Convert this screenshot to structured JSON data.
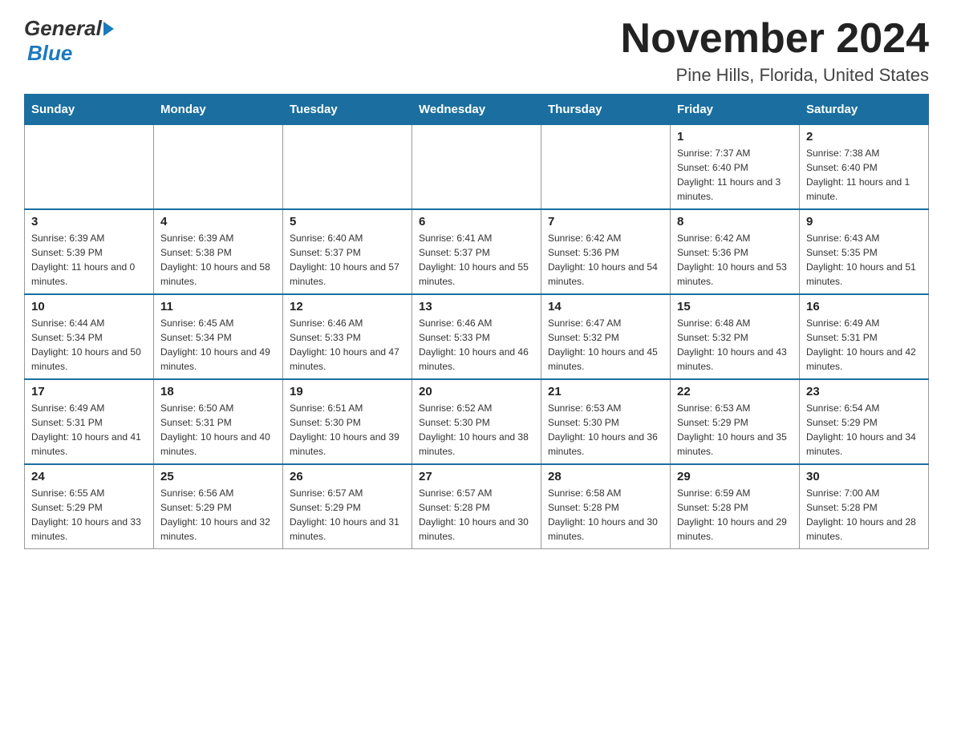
{
  "header": {
    "title": "November 2024",
    "subtitle": "Pine Hills, Florida, United States",
    "logo_general": "General",
    "logo_blue": "Blue"
  },
  "days_of_week": [
    "Sunday",
    "Monday",
    "Tuesday",
    "Wednesday",
    "Thursday",
    "Friday",
    "Saturday"
  ],
  "weeks": [
    [
      {
        "day": "",
        "info": ""
      },
      {
        "day": "",
        "info": ""
      },
      {
        "day": "",
        "info": ""
      },
      {
        "day": "",
        "info": ""
      },
      {
        "day": "",
        "info": ""
      },
      {
        "day": "1",
        "info": "Sunrise: 7:37 AM\nSunset: 6:40 PM\nDaylight: 11 hours and 3 minutes."
      },
      {
        "day": "2",
        "info": "Sunrise: 7:38 AM\nSunset: 6:40 PM\nDaylight: 11 hours and 1 minute."
      }
    ],
    [
      {
        "day": "3",
        "info": "Sunrise: 6:39 AM\nSunset: 5:39 PM\nDaylight: 11 hours and 0 minutes."
      },
      {
        "day": "4",
        "info": "Sunrise: 6:39 AM\nSunset: 5:38 PM\nDaylight: 10 hours and 58 minutes."
      },
      {
        "day": "5",
        "info": "Sunrise: 6:40 AM\nSunset: 5:37 PM\nDaylight: 10 hours and 57 minutes."
      },
      {
        "day": "6",
        "info": "Sunrise: 6:41 AM\nSunset: 5:37 PM\nDaylight: 10 hours and 55 minutes."
      },
      {
        "day": "7",
        "info": "Sunrise: 6:42 AM\nSunset: 5:36 PM\nDaylight: 10 hours and 54 minutes."
      },
      {
        "day": "8",
        "info": "Sunrise: 6:42 AM\nSunset: 5:36 PM\nDaylight: 10 hours and 53 minutes."
      },
      {
        "day": "9",
        "info": "Sunrise: 6:43 AM\nSunset: 5:35 PM\nDaylight: 10 hours and 51 minutes."
      }
    ],
    [
      {
        "day": "10",
        "info": "Sunrise: 6:44 AM\nSunset: 5:34 PM\nDaylight: 10 hours and 50 minutes."
      },
      {
        "day": "11",
        "info": "Sunrise: 6:45 AM\nSunset: 5:34 PM\nDaylight: 10 hours and 49 minutes."
      },
      {
        "day": "12",
        "info": "Sunrise: 6:46 AM\nSunset: 5:33 PM\nDaylight: 10 hours and 47 minutes."
      },
      {
        "day": "13",
        "info": "Sunrise: 6:46 AM\nSunset: 5:33 PM\nDaylight: 10 hours and 46 minutes."
      },
      {
        "day": "14",
        "info": "Sunrise: 6:47 AM\nSunset: 5:32 PM\nDaylight: 10 hours and 45 minutes."
      },
      {
        "day": "15",
        "info": "Sunrise: 6:48 AM\nSunset: 5:32 PM\nDaylight: 10 hours and 43 minutes."
      },
      {
        "day": "16",
        "info": "Sunrise: 6:49 AM\nSunset: 5:31 PM\nDaylight: 10 hours and 42 minutes."
      }
    ],
    [
      {
        "day": "17",
        "info": "Sunrise: 6:49 AM\nSunset: 5:31 PM\nDaylight: 10 hours and 41 minutes."
      },
      {
        "day": "18",
        "info": "Sunrise: 6:50 AM\nSunset: 5:31 PM\nDaylight: 10 hours and 40 minutes."
      },
      {
        "day": "19",
        "info": "Sunrise: 6:51 AM\nSunset: 5:30 PM\nDaylight: 10 hours and 39 minutes."
      },
      {
        "day": "20",
        "info": "Sunrise: 6:52 AM\nSunset: 5:30 PM\nDaylight: 10 hours and 38 minutes."
      },
      {
        "day": "21",
        "info": "Sunrise: 6:53 AM\nSunset: 5:30 PM\nDaylight: 10 hours and 36 minutes."
      },
      {
        "day": "22",
        "info": "Sunrise: 6:53 AM\nSunset: 5:29 PM\nDaylight: 10 hours and 35 minutes."
      },
      {
        "day": "23",
        "info": "Sunrise: 6:54 AM\nSunset: 5:29 PM\nDaylight: 10 hours and 34 minutes."
      }
    ],
    [
      {
        "day": "24",
        "info": "Sunrise: 6:55 AM\nSunset: 5:29 PM\nDaylight: 10 hours and 33 minutes."
      },
      {
        "day": "25",
        "info": "Sunrise: 6:56 AM\nSunset: 5:29 PM\nDaylight: 10 hours and 32 minutes."
      },
      {
        "day": "26",
        "info": "Sunrise: 6:57 AM\nSunset: 5:29 PM\nDaylight: 10 hours and 31 minutes."
      },
      {
        "day": "27",
        "info": "Sunrise: 6:57 AM\nSunset: 5:28 PM\nDaylight: 10 hours and 30 minutes."
      },
      {
        "day": "28",
        "info": "Sunrise: 6:58 AM\nSunset: 5:28 PM\nDaylight: 10 hours and 30 minutes."
      },
      {
        "day": "29",
        "info": "Sunrise: 6:59 AM\nSunset: 5:28 PM\nDaylight: 10 hours and 29 minutes."
      },
      {
        "day": "30",
        "info": "Sunrise: 7:00 AM\nSunset: 5:28 PM\nDaylight: 10 hours and 28 minutes."
      }
    ]
  ]
}
